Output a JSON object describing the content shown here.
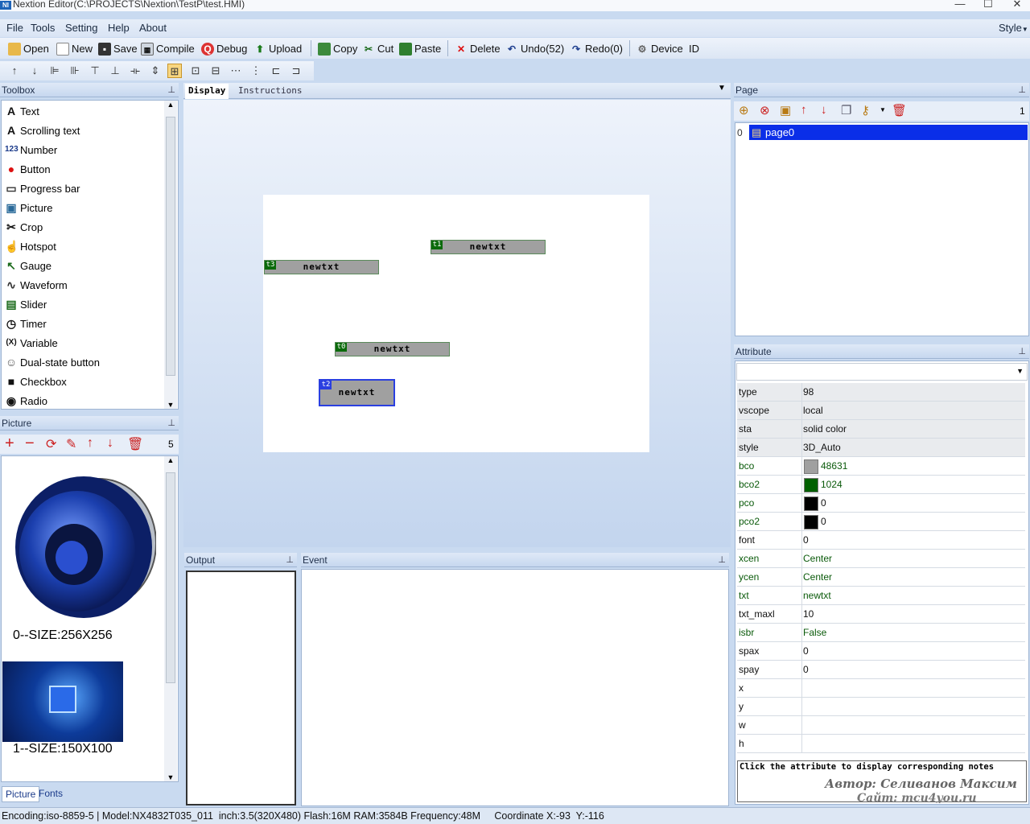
{
  "window": {
    "title": "Nextion Editor(C:\\PROJECTS\\Nextion\\TestP\\test.HMI)",
    "app_icon": "NI",
    "minimize": "—",
    "maximize": "☐",
    "close": "✕"
  },
  "menu": {
    "items": [
      "File",
      "Tools",
      "Setting",
      "Help",
      "About"
    ],
    "style": "Style"
  },
  "toolbar": {
    "open": "Open",
    "new": "New",
    "save": "Save",
    "compile": "Compile",
    "debug": "Debug",
    "upload": "Upload",
    "copy": "Copy",
    "cut": "Cut",
    "paste": "Paste",
    "delete": "Delete",
    "undo": "Undo(52)",
    "redo": "Redo(0)",
    "device_id": "Device  ID"
  },
  "toolbox": {
    "title": "Toolbox",
    "items": [
      "Text",
      "Scrolling text",
      "Number",
      "Button",
      "Progress bar",
      "Picture",
      "Crop",
      "Hotspot",
      "Gauge",
      "Waveform",
      "Slider",
      "Timer",
      "Variable",
      "Dual-state button",
      "Checkbox",
      "Radio"
    ],
    "icons": [
      "A",
      "A",
      "123",
      "●",
      "▭",
      "▣",
      "✂",
      "☝",
      "↖",
      "∿",
      "▤",
      "◷",
      "(X)",
      "☺",
      "■",
      "◉"
    ]
  },
  "editor": {
    "tabs": [
      "Display",
      "Instructions"
    ]
  },
  "components": [
    {
      "id": "t1",
      "text": "newtxt"
    },
    {
      "id": "t3",
      "text": "newtxt"
    },
    {
      "id": "t0",
      "text": "newtxt"
    },
    {
      "id": "t2",
      "text": "newtxt"
    }
  ],
  "picture_panel": {
    "title": "Picture",
    "count": "5",
    "items": [
      "0--SIZE:256X256",
      "1--SIZE:150X100"
    ],
    "tabs": [
      "Picture",
      "Fonts"
    ]
  },
  "output": {
    "title": "Output"
  },
  "event": {
    "title": "Event"
  },
  "page_panel": {
    "title": "Page",
    "count": "1",
    "pages": [
      {
        "index": "0",
        "name": "page0"
      }
    ]
  },
  "attribute": {
    "title": "Attribute",
    "rows": [
      {
        "key": "type",
        "value": "98"
      },
      {
        "key": "vscope",
        "value": "local"
      },
      {
        "key": "sta",
        "value": "solid color"
      },
      {
        "key": "style",
        "value": "3D_Auto"
      },
      {
        "key": "bco",
        "value": "48631",
        "swatch": "#a0a0a0"
      },
      {
        "key": "bco2",
        "value": "1024",
        "swatch": "#006000"
      },
      {
        "key": "pco",
        "value": "0",
        "swatch": "#000000"
      },
      {
        "key": "pco2",
        "value": "0",
        "swatch": "#000000"
      },
      {
        "key": "font",
        "value": "0"
      },
      {
        "key": "xcen",
        "value": "Center"
      },
      {
        "key": "ycen",
        "value": "Center"
      },
      {
        "key": "txt",
        "value": "newtxt"
      },
      {
        "key": "txt_maxl",
        "value": "10"
      },
      {
        "key": "isbr",
        "value": "False"
      },
      {
        "key": "spax",
        "value": "0"
      },
      {
        "key": "spay",
        "value": "0"
      },
      {
        "key": "x",
        "value": ""
      },
      {
        "key": "y",
        "value": ""
      },
      {
        "key": "w",
        "value": ""
      },
      {
        "key": "h",
        "value": ""
      }
    ],
    "note": "Click the attribute to display corresponding notes",
    "author": "Автор: Селиванов Максим",
    "site": "Сайт: mcu4you.ru"
  },
  "status": "Encoding:iso-8859-5 | Model:NX4832T035_011  inch:3.5(320X480) Flash:16M RAM:3584B Frequency:48M     Coordinate X:-93  Y:-116",
  "colors": {
    "green_key": "#0a5a0a",
    "selection": "#0a2ee8",
    "canvas_bg": "#c9daf0"
  }
}
